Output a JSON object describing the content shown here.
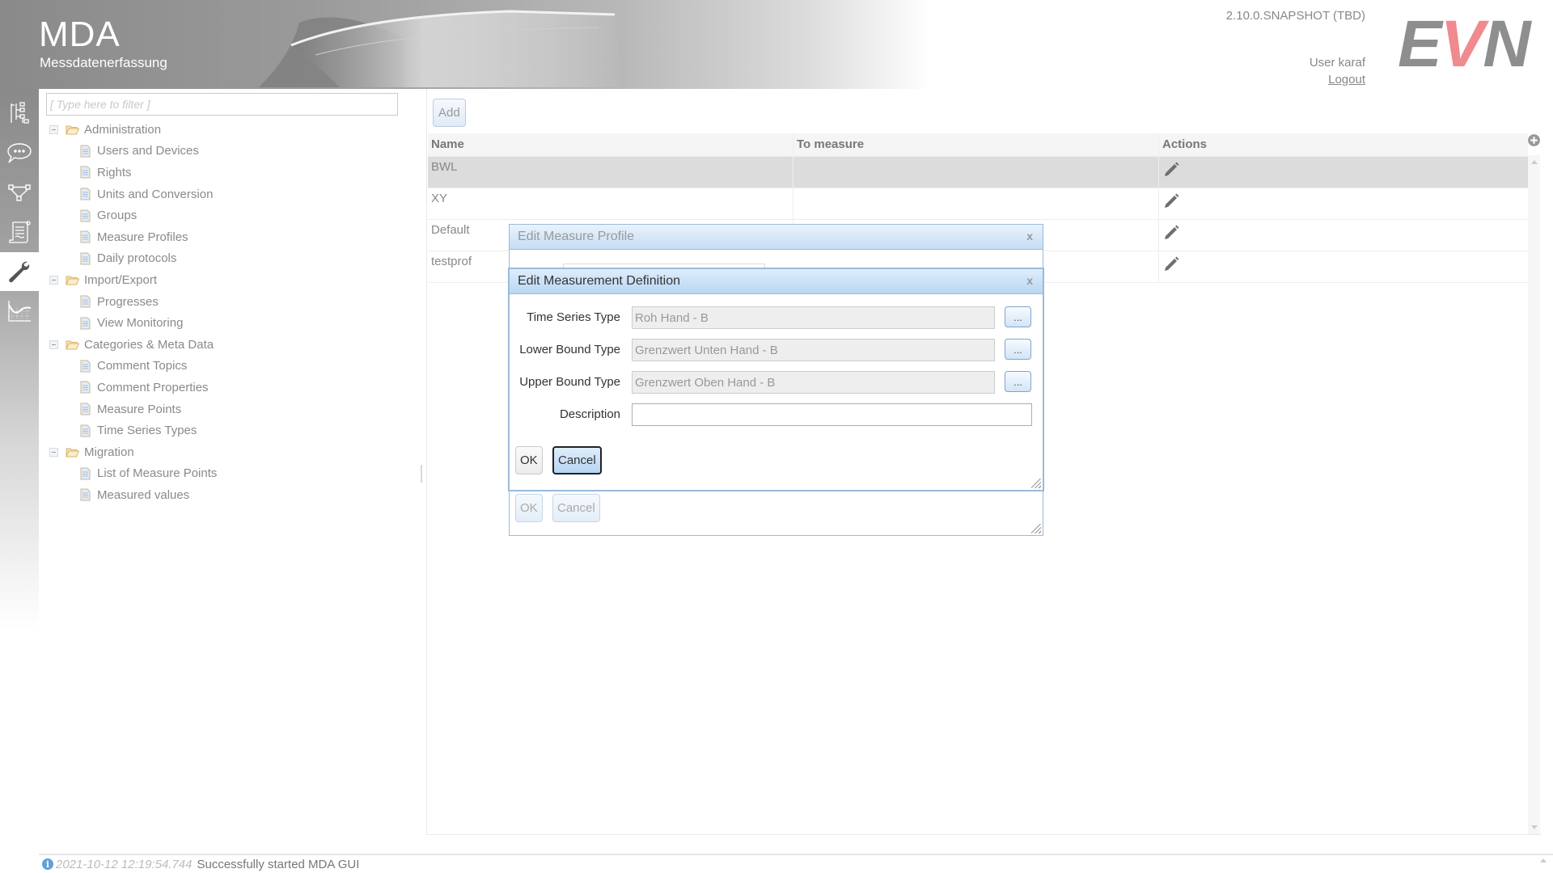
{
  "header": {
    "app_title": "MDA",
    "app_subtitle": "Messdatenerfassung",
    "version": "2.10.0.SNAPSHOT (TBD)",
    "user_label": "User karaf",
    "logout_label": "Logout",
    "logo": {
      "e": "E",
      "v": "V",
      "n": "N",
      "accent_color": "#f08a8f"
    }
  },
  "iconbar": {
    "items": [
      {
        "name": "hierarchy-icon",
        "active": false
      },
      {
        "name": "comment-icon",
        "active": false
      },
      {
        "name": "workflow-icon",
        "active": false
      },
      {
        "name": "protocol-scroll-icon",
        "active": false
      },
      {
        "name": "wrench-icon",
        "active": true
      },
      {
        "name": "chart-icon",
        "active": false
      }
    ]
  },
  "tree": {
    "filter_placeholder": "[ Type here to filter ]",
    "nodes": [
      {
        "type": "folder",
        "label": "Administration"
      },
      {
        "type": "leaf",
        "label": "Users and Devices"
      },
      {
        "type": "leaf",
        "label": "Rights"
      },
      {
        "type": "leaf",
        "label": "Units and Conversion"
      },
      {
        "type": "leaf",
        "label": "Groups"
      },
      {
        "type": "leaf",
        "label": "Measure Profiles"
      },
      {
        "type": "leaf",
        "label": "Daily protocols"
      },
      {
        "type": "folder",
        "label": "Import/Export"
      },
      {
        "type": "leaf",
        "label": "Progresses"
      },
      {
        "type": "leaf",
        "label": "View Monitoring"
      },
      {
        "type": "folder",
        "label": "Categories & Meta Data"
      },
      {
        "type": "leaf",
        "label": "Comment Topics"
      },
      {
        "type": "leaf",
        "label": "Comment Properties"
      },
      {
        "type": "leaf",
        "label": "Measure Points"
      },
      {
        "type": "leaf",
        "label": "Time Series Types"
      },
      {
        "type": "folder",
        "label": "Migration"
      },
      {
        "type": "leaf",
        "label": "List of Measure Points"
      },
      {
        "type": "leaf",
        "label": "Measured values"
      }
    ]
  },
  "table": {
    "add_label": "Add",
    "columns": [
      "Name",
      "To measure",
      "Actions"
    ],
    "rows": [
      {
        "name": "BWL",
        "to_measure": "",
        "selected": true
      },
      {
        "name": "XY",
        "to_measure": "",
        "selected": false
      },
      {
        "name": "Default",
        "to_measure": "",
        "selected": false
      },
      {
        "name": "testprof",
        "to_measure": "",
        "selected": false
      }
    ]
  },
  "outer_dialog": {
    "title": "Edit Measure Profile",
    "close_label": "x",
    "ok_label": "OK",
    "cancel_label": "Cancel"
  },
  "inner_dialog": {
    "title": "Edit Measurement Definition",
    "close_label": "x",
    "fields": [
      {
        "label": "Time Series Type",
        "value": "Roh Hand - B",
        "button": "..."
      },
      {
        "label": "Lower Bound Type",
        "value": "Grenzwert Unten Hand - B",
        "button": "..."
      },
      {
        "label": "Upper Bound Type",
        "value": "Grenzwert Oben Hand - B",
        "button": "..."
      }
    ],
    "description_label": "Description",
    "description_value": "",
    "ok_label": "OK",
    "cancel_label": "Cancel"
  },
  "status": {
    "timestamp": "2021-10-12 12:19:54.744",
    "message": "Successfully started MDA GUI"
  }
}
